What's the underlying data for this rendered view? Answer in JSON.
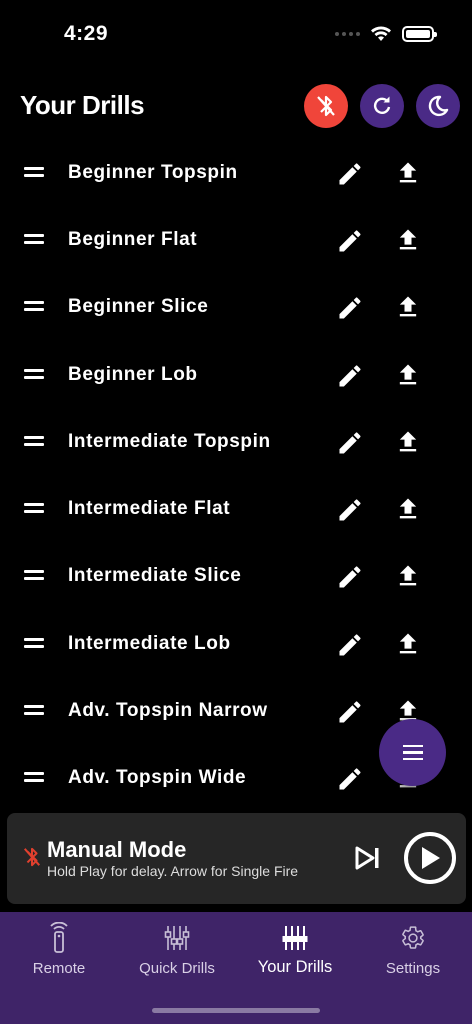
{
  "status_bar": {
    "time": "4:29"
  },
  "header": {
    "title": "Your Drills",
    "actions": [
      {
        "icon": "bluetooth-disabled-icon",
        "color": "#f0453a"
      },
      {
        "icon": "refresh-icon",
        "color": "#4a2a86"
      },
      {
        "icon": "moon-icon",
        "color": "#4a2a86"
      }
    ]
  },
  "drills": [
    {
      "name": "Beginner Topspin"
    },
    {
      "name": "Beginner Flat"
    },
    {
      "name": "Beginner Slice"
    },
    {
      "name": "Beginner Lob"
    },
    {
      "name": "Intermediate Topspin"
    },
    {
      "name": "Intermediate Flat"
    },
    {
      "name": "Intermediate Slice"
    },
    {
      "name": "Intermediate Lob"
    },
    {
      "name": "Adv. Topspin Narrow"
    },
    {
      "name": "Adv. Topspin Wide"
    }
  ],
  "player": {
    "title": "Manual Mode",
    "subtitle": "Hold Play for delay. Arrow for Single Fire",
    "bt_status_color": "#e0402e"
  },
  "tabs": [
    {
      "label": "Remote",
      "icon": "remote-icon",
      "active": false
    },
    {
      "label": "Quick Drills",
      "icon": "sliders-icon",
      "active": false
    },
    {
      "label": "Your Drills",
      "icon": "sliders-icon",
      "active": true
    },
    {
      "label": "Settings",
      "icon": "gear-icon",
      "active": false
    }
  ],
  "colors": {
    "accent": "#4a2a86",
    "tab_bar": "#3f2468",
    "alert": "#f0453a"
  }
}
